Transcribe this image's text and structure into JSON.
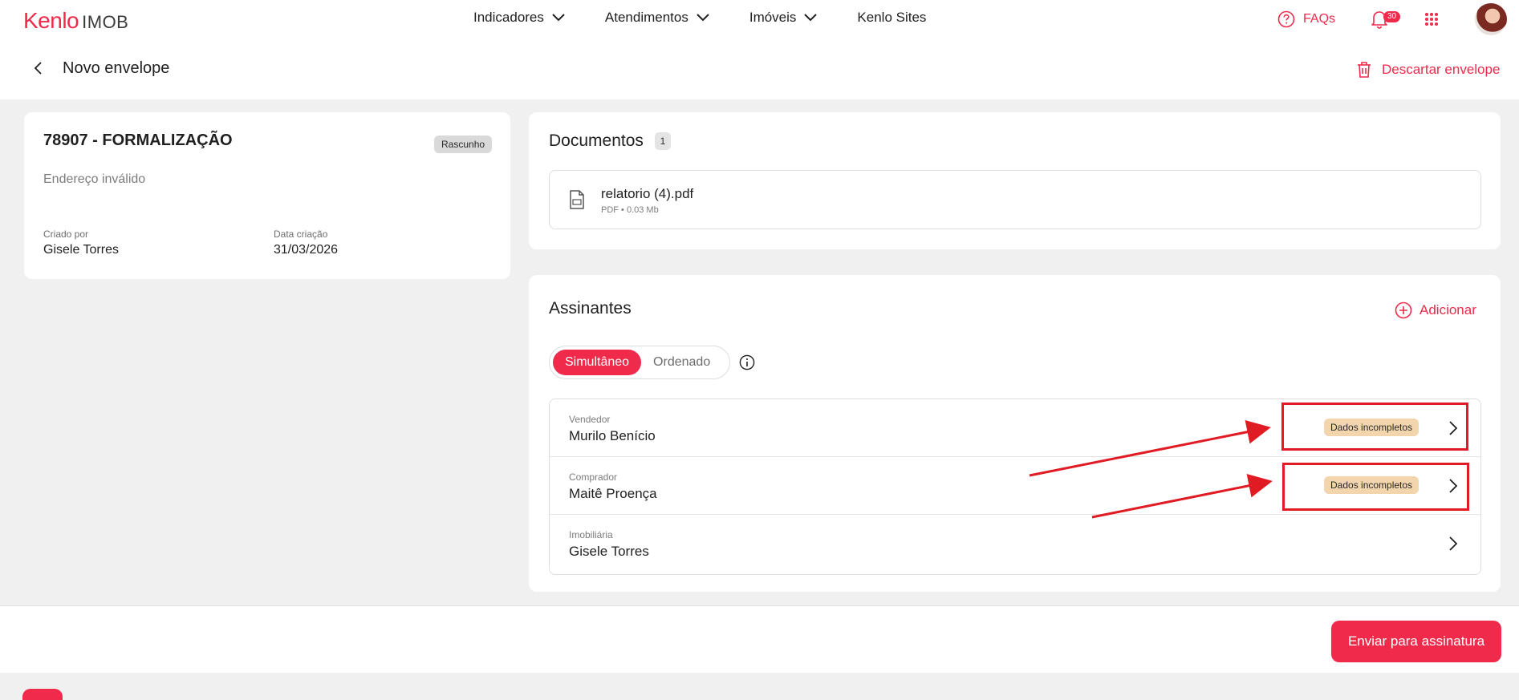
{
  "header": {
    "logo_brand": "Kenlo",
    "logo_product": "IMOB",
    "nav": [
      {
        "label": "Indicadores"
      },
      {
        "label": "Atendimentos"
      },
      {
        "label": "Imóveis"
      },
      {
        "label": "Kenlo Sites"
      }
    ],
    "faqs_label": "FAQs",
    "notifications_count": "30",
    "accent_color": "#ef2a4a"
  },
  "subheader": {
    "title": "Novo envelope",
    "discard_label": "Descartar envelope"
  },
  "envelope": {
    "title": "78907 - FORMALIZAÇÃO",
    "status": "Rascunho",
    "address": "Endereço inválido",
    "created_by_label": "Criado por",
    "created_by": "Gisele Torres",
    "created_date_label": "Data criação",
    "created_date": "31/03/2026"
  },
  "documents": {
    "title": "Documentos",
    "count": "1",
    "items": [
      {
        "name": "relatorio (4).pdf",
        "meta": "PDF • 0.03 Mb"
      }
    ]
  },
  "signers": {
    "title": "Assinantes",
    "add_label": "Adicionar",
    "mode_options": [
      "Simultâneo",
      "Ordenado"
    ],
    "mode_selected": "Simultâneo",
    "items": [
      {
        "role": "Vendedor",
        "name": "Murilo Benício",
        "status": "Dados incompletos"
      },
      {
        "role": "Comprador",
        "name": "Maitê Proença",
        "status": "Dados incompletos"
      },
      {
        "role": "Imobiliária",
        "name": "Gisele Torres",
        "status": ""
      }
    ]
  },
  "footer": {
    "submit_label": "Enviar para assinatura"
  }
}
